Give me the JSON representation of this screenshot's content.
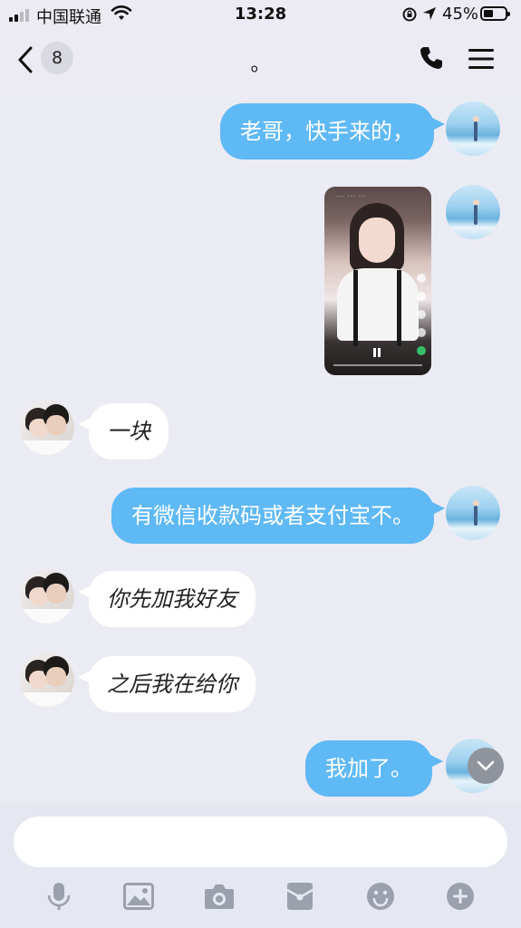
{
  "status_bar": {
    "carrier": "中国联通",
    "time": "13:28",
    "battery": "45%",
    "battery_level": 0.45
  },
  "nav": {
    "back_badge": "8",
    "title": "。"
  },
  "messages": [
    {
      "side": "right",
      "text": "老哥，快手来的，"
    },
    {
      "side": "right",
      "type": "video"
    },
    {
      "side": "left",
      "text": "一块"
    },
    {
      "side": "right",
      "text": "有微信收款码或者支付宝不。"
    },
    {
      "side": "left",
      "text": "你先加我好友"
    },
    {
      "side": "left",
      "text": "之后我在给你"
    },
    {
      "side": "right",
      "text": "我加了。"
    }
  ],
  "input": {
    "placeholder": "",
    "value": ""
  },
  "colors": {
    "bubble_out": "#5fb9f5",
    "bubble_in": "#ffffff",
    "background": "#ebebf3"
  },
  "toolbar_icons": [
    "microphone-icon",
    "image-icon",
    "camera-icon",
    "red-packet-icon",
    "emoji-icon",
    "plus-icon"
  ]
}
